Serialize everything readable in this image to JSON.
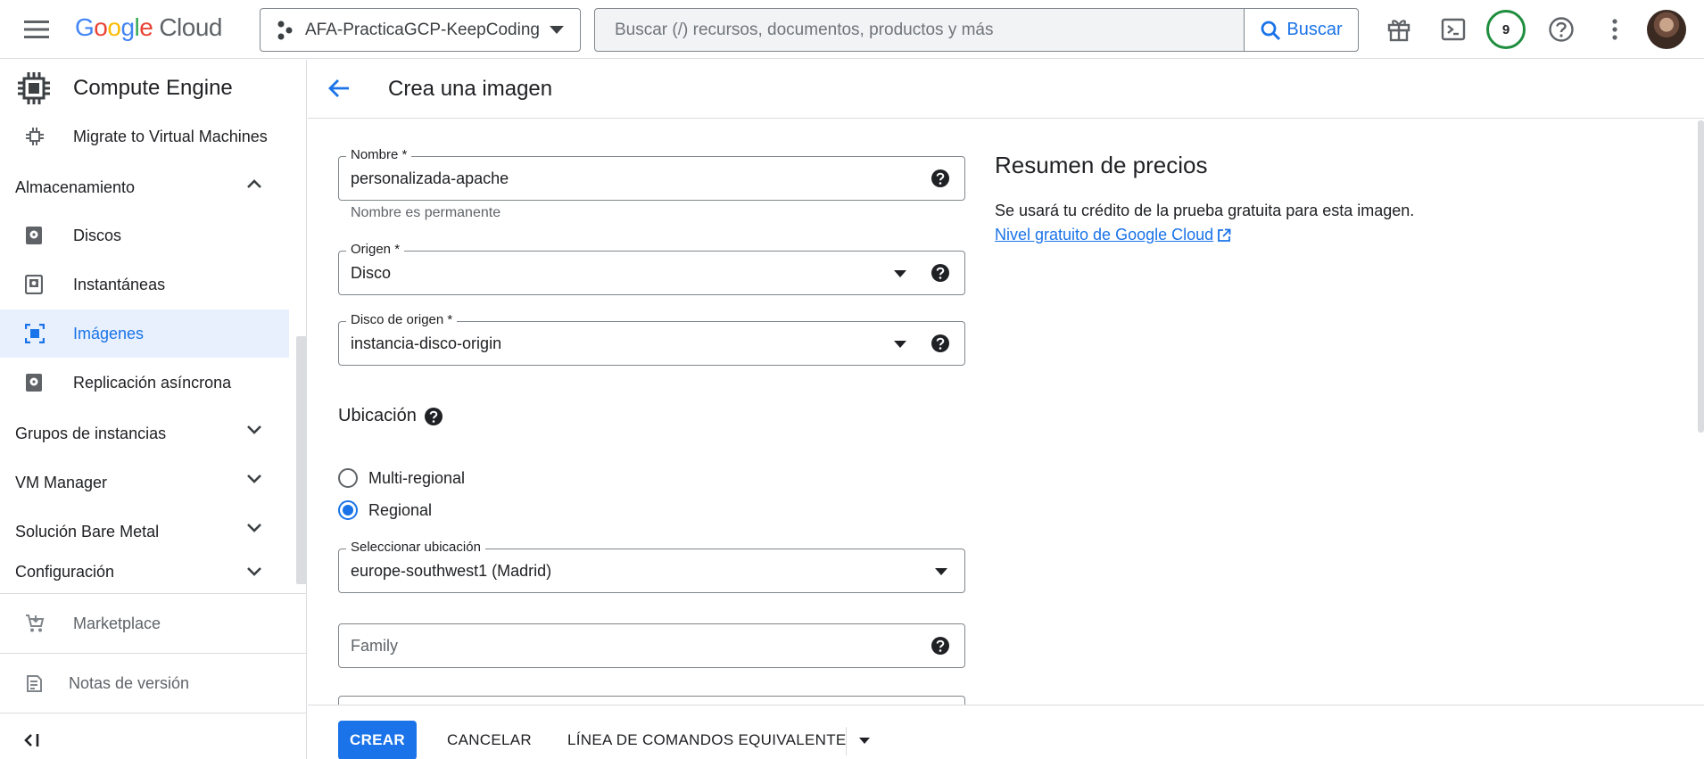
{
  "topbar": {
    "logo_brand": [
      "G",
      "o",
      "o",
      "g",
      "l",
      "e"
    ],
    "logo_cloud": "Cloud",
    "project_name": "AFA-PracticaGCP-KeepCoding",
    "search_placeholder": "Buscar (/) recursos, documentos, productos y más",
    "search_button": "Buscar",
    "notifications_count": "9"
  },
  "colors": {
    "accent": "#1a73e8",
    "active_bg": "#e8f0fe",
    "badge_ring": "#1e8e3e",
    "logo": [
      "#4285f4",
      "#ea4335",
      "#fbbc04",
      "#4285f4",
      "#34a853",
      "#ea4335"
    ]
  },
  "sidenav": {
    "title": "Compute Engine",
    "items": [
      {
        "label": "Migrate to Virtual Machines",
        "icon": "migrate-icon"
      },
      {
        "label": "Almacenamiento",
        "icon": "chevron-up-icon"
      },
      {
        "label": "Discos",
        "icon": "disk-icon"
      },
      {
        "label": "Instantáneas",
        "icon": "snapshot-icon"
      },
      {
        "label": "Imágenes",
        "icon": "image-icon",
        "active": true
      },
      {
        "label": "Replicación asíncrona",
        "icon": "replication-icon"
      },
      {
        "label": "Grupos de instancias",
        "icon": "chevron-down-icon"
      },
      {
        "label": "VM Manager",
        "icon": "chevron-down-icon"
      },
      {
        "label": "Solución Bare Metal",
        "icon": "chevron-down-icon"
      },
      {
        "label": "Configuración",
        "icon": "chevron-down-icon"
      }
    ],
    "marketplace": "Marketplace",
    "release_notes": "Notas de versión"
  },
  "page": {
    "title": "Crea una imagen"
  },
  "form": {
    "nombre_label": "Nombre *",
    "nombre_value": "personalizada-apache",
    "nombre_hint": "Nombre es permanente",
    "origen_label": "Origen *",
    "origen_value": "Disco",
    "disco_label": "Disco de origen *",
    "disco_value": "instancia-disco-origin",
    "ubicacion_heading": "Ubicación",
    "radio_multi": "Multi-regional",
    "radio_regional": "Regional",
    "radio_selected": "Regional",
    "location_label": "Seleccionar ubicación",
    "location_value": "europe-southwest1 (Madrid)",
    "family_placeholder": "Family"
  },
  "pricing": {
    "title": "Resumen de precios",
    "text": "Se usará tu crédito de la prueba gratuita para esta imagen.",
    "link": "Nivel gratuito de Google Cloud"
  },
  "actions": {
    "create": "CREAR",
    "cancel": "CANCELAR",
    "command_line": "LÍNEA DE COMANDOS EQUIVALENTE"
  }
}
